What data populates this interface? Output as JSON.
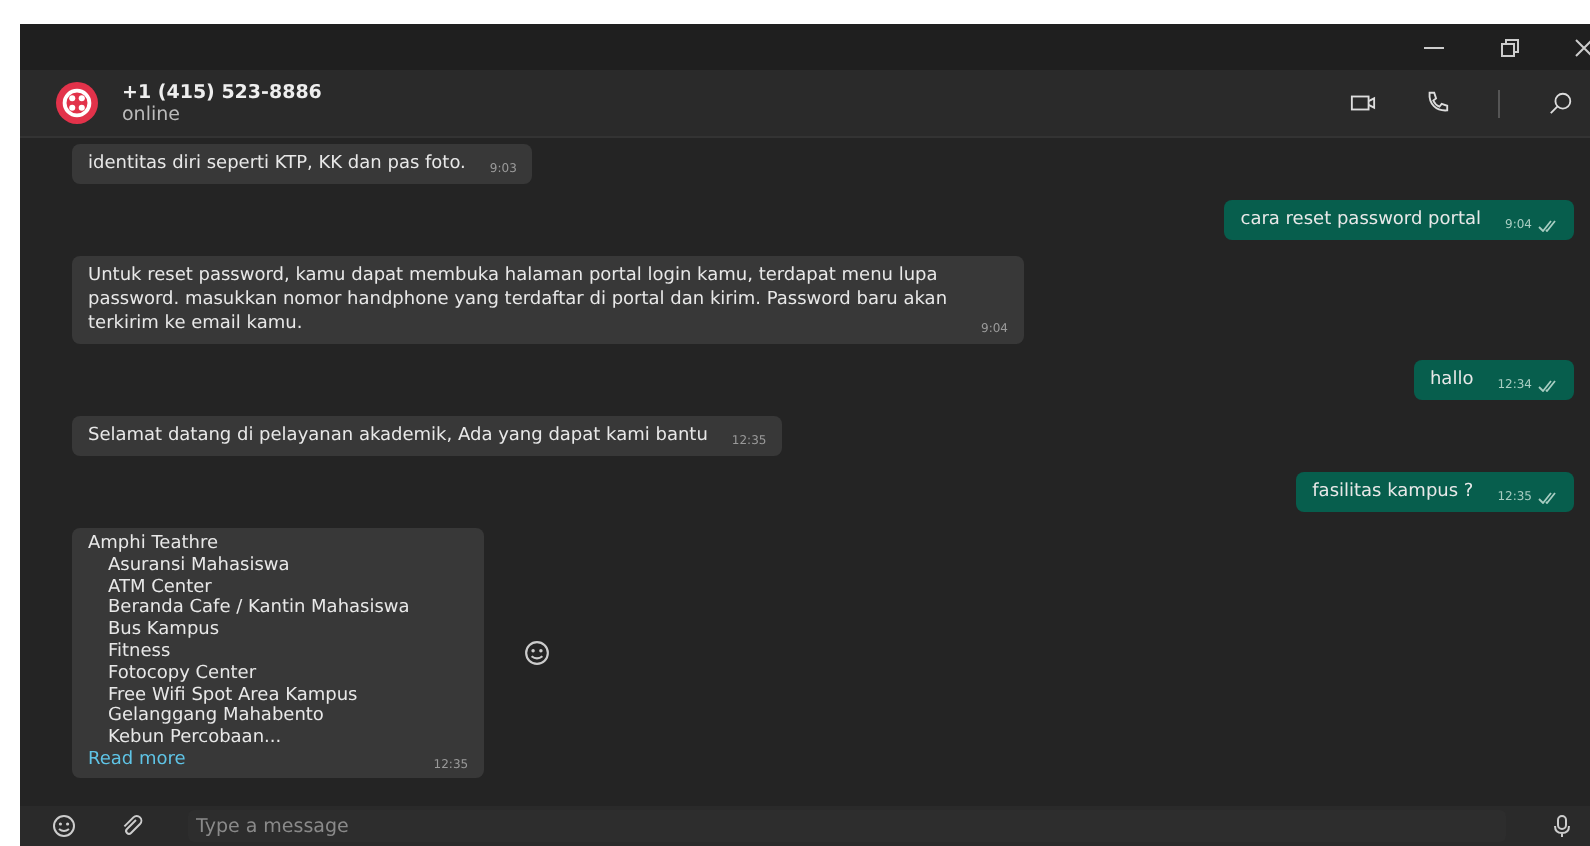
{
  "contact": {
    "name": "+1 (415) 523-8886",
    "status": "online"
  },
  "messages": [
    {
      "kind": "text",
      "outgoing": false,
      "text": "identitas diri seperti KTP, KK dan pas foto.",
      "time": "9:03"
    },
    {
      "kind": "text",
      "outgoing": true,
      "text": "cara reset password portal",
      "time": "9:04",
      "read": true
    },
    {
      "kind": "text",
      "outgoing": false,
      "text": "Untuk reset password, kamu dapat membuka halaman portal login kamu, terdapat menu lupa password. masukkan nomor handphone yang terdaftar di portal dan kirim. Password baru akan terkirim ke email kamu.",
      "time": "9:04"
    },
    {
      "kind": "text",
      "outgoing": true,
      "text": "hallo",
      "time": "12:34",
      "read": true
    },
    {
      "kind": "text",
      "outgoing": false,
      "text": "Selamat datang di pelayanan akademik, Ada yang dapat kami bantu",
      "time": "12:35"
    },
    {
      "kind": "text",
      "outgoing": true,
      "text": "fasilitas kampus ?",
      "time": "12:35",
      "read": true
    },
    {
      "kind": "list",
      "outgoing": false,
      "title": "Amphi Teathre",
      "items": [
        "Asuransi Mahasiswa",
        "ATM Center",
        "Beranda Cafe / Kantin Mahasiswa",
        "Bus Kampus",
        "Fitness",
        "Fotocopy Center",
        "Free Wifi Spot Area Kampus",
        "Gelanggang Mahabento",
        "Kebun Percobaan..."
      ],
      "link": "Read more",
      "time": "12:35"
    }
  ],
  "composer": {
    "placeholder": "Type a message"
  }
}
